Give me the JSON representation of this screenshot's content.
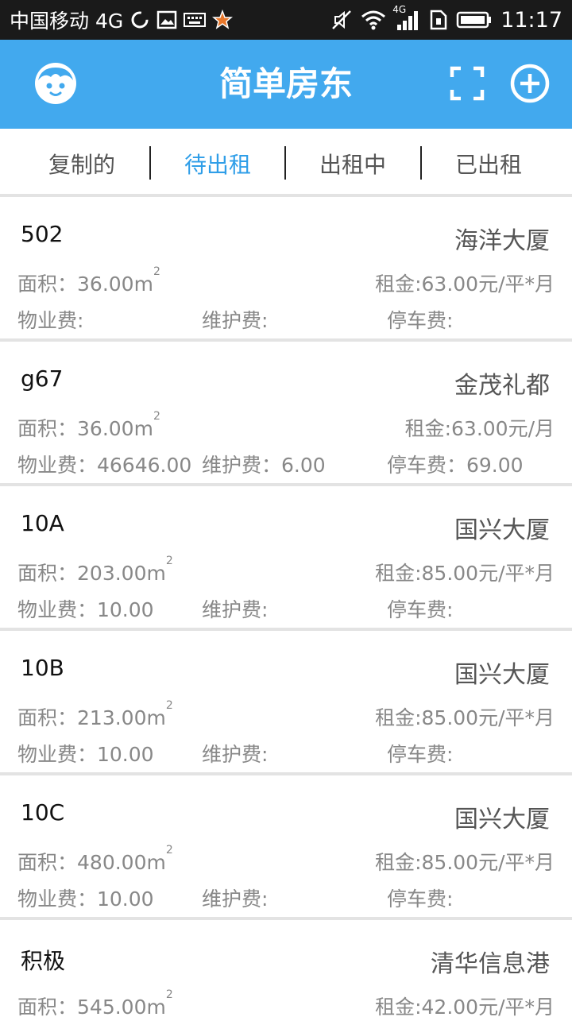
{
  "status_bar": {
    "carrier": "中国移动 4G",
    "network_label": "4G",
    "time": "11:17"
  },
  "app_bar": {
    "title": "简单房东",
    "icons": [
      "avatar-face-icon",
      "scan-icon",
      "add-circle-icon"
    ]
  },
  "tabs": [
    {
      "label": "复制的",
      "active": false
    },
    {
      "label": "待出租",
      "active": true
    },
    {
      "label": "出租中",
      "active": false
    },
    {
      "label": "已出租",
      "active": false
    }
  ],
  "colors": {
    "app_bar": "#42a9ee",
    "active_tab": "#2f9ee8",
    "status_bar": "#1a1a1a"
  },
  "labels": {
    "area": "面积：",
    "area_unit": "m",
    "area_unit_sup": "2",
    "property_fee": "物业费：",
    "maintenance_fee": "维护费：",
    "parking_fee": "停车费：",
    "property_fee_empty": "物业费:",
    "maintenance_fee_empty": "维护费:",
    "parking_fee_empty": "停车费:"
  },
  "listings": [
    {
      "name": "502",
      "building": "海洋大厦",
      "area_value": "36.00",
      "rent": "租金:63.00元/平*月",
      "property_fee": "物业费:",
      "maintenance_fee": "维护费:",
      "parking_fee": "停车费:"
    },
    {
      "name": "g67",
      "building": "金茂礼都",
      "area_value": "36.00",
      "rent": "租金:63.00元/月",
      "property_fee": "物业费：46646.00",
      "maintenance_fee": "维护费：6.00",
      "parking_fee": "停车费：69.00"
    },
    {
      "name": "10A",
      "building": "国兴大厦",
      "area_value": "203.00",
      "rent": "租金:85.00元/平*月",
      "property_fee": "物业费：10.00",
      "maintenance_fee": "维护费:",
      "parking_fee": "停车费:"
    },
    {
      "name": "10B",
      "building": "国兴大厦",
      "area_value": "213.00",
      "rent": "租金:85.00元/平*月",
      "property_fee": "物业费：10.00",
      "maintenance_fee": "维护费:",
      "parking_fee": "停车费:"
    },
    {
      "name": "10C",
      "building": "国兴大厦",
      "area_value": "480.00",
      "rent": "租金:85.00元/平*月",
      "property_fee": "物业费：10.00",
      "maintenance_fee": "维护费:",
      "parking_fee": "停车费:"
    },
    {
      "name": "积极",
      "building": "清华信息港",
      "area_value": "545.00",
      "rent": "租金:42.00元/平*月",
      "property_fee": "",
      "maintenance_fee": "",
      "parking_fee": ""
    }
  ]
}
